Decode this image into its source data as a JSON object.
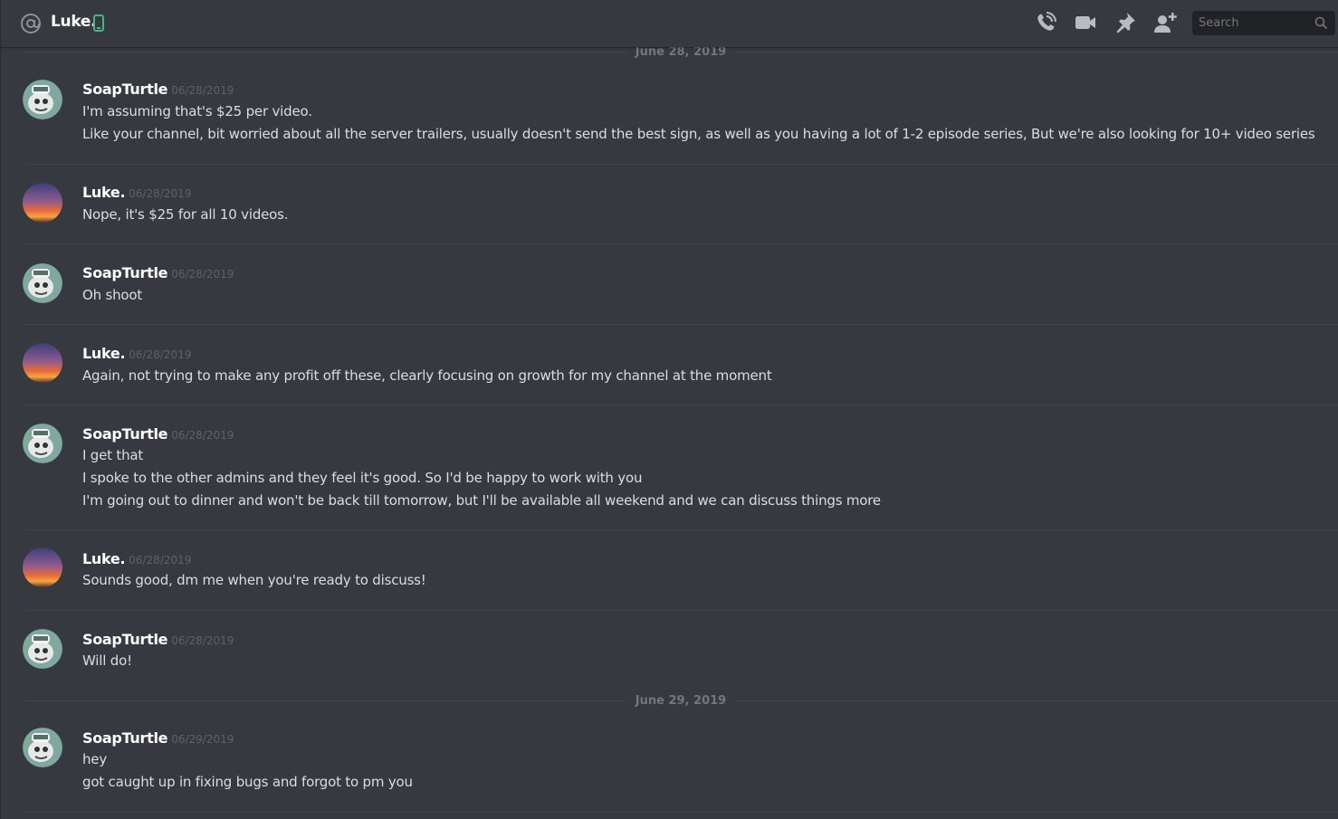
{
  "header": {
    "channel_icon": "at-sign-icon",
    "dm_name": "Luke.",
    "status_icon": "mobile-phone-icon",
    "status_color": "#43b581",
    "toolbar_icons": [
      "start-voice-call-icon",
      "start-video-call-icon",
      "pinned-messages-icon",
      "add-friend-to-dm-icon"
    ],
    "search": {
      "placeholder": "Search",
      "value": ""
    }
  },
  "colors": {
    "background": "#36393f",
    "username": "#ffffff",
    "text": "#dcddde",
    "muted": "#72767d"
  },
  "dates": [
    "June 28, 2019",
    "June 29, 2019"
  ],
  "messages": [
    {
      "author": "SoapTurtle",
      "avatar": "turtle-avatar",
      "timestamp": "06/28/2019",
      "lines": [
        "I'm assuming that's $25 per video.",
        "Like your channel, bit worried about all the server trailers, usually doesn't send the best sign, as well as you having a lot of 1-2 episode series, But we're also looking for 10+ video series"
      ]
    },
    {
      "author": "Luke.",
      "avatar": "sunset-avatar",
      "timestamp": "06/28/2019",
      "lines": [
        "Nope, it's $25 for all 10 videos."
      ]
    },
    {
      "author": "SoapTurtle",
      "avatar": "turtle-avatar",
      "timestamp": "06/28/2019",
      "lines": [
        "Oh shoot"
      ]
    },
    {
      "author": "Luke.",
      "avatar": "sunset-avatar",
      "timestamp": "06/28/2019",
      "lines": [
        "Again, not trying to make any profit off these, clearly focusing on growth for my channel at the moment"
      ]
    },
    {
      "author": "SoapTurtle",
      "avatar": "turtle-avatar",
      "timestamp": "06/28/2019",
      "lines": [
        "I get that",
        "I spoke to the other admins and they feel it's good. So I'd be happy to work with you",
        "I'm going out to dinner and won't be back till tomorrow, but I'll be available all weekend and we can discuss things more"
      ]
    },
    {
      "author": "Luke.",
      "avatar": "sunset-avatar",
      "timestamp": "06/28/2019",
      "lines": [
        "Sounds good, dm me when you're ready to discuss!"
      ]
    },
    {
      "author": "SoapTurtle",
      "avatar": "turtle-avatar",
      "timestamp": "06/28/2019",
      "lines": [
        "Will do!"
      ]
    },
    {
      "author": "SoapTurtle",
      "avatar": "turtle-avatar",
      "timestamp": "06/29/2019",
      "lines": [
        "hey",
        "got caught up in fixing bugs and forgot to pm you"
      ]
    }
  ]
}
